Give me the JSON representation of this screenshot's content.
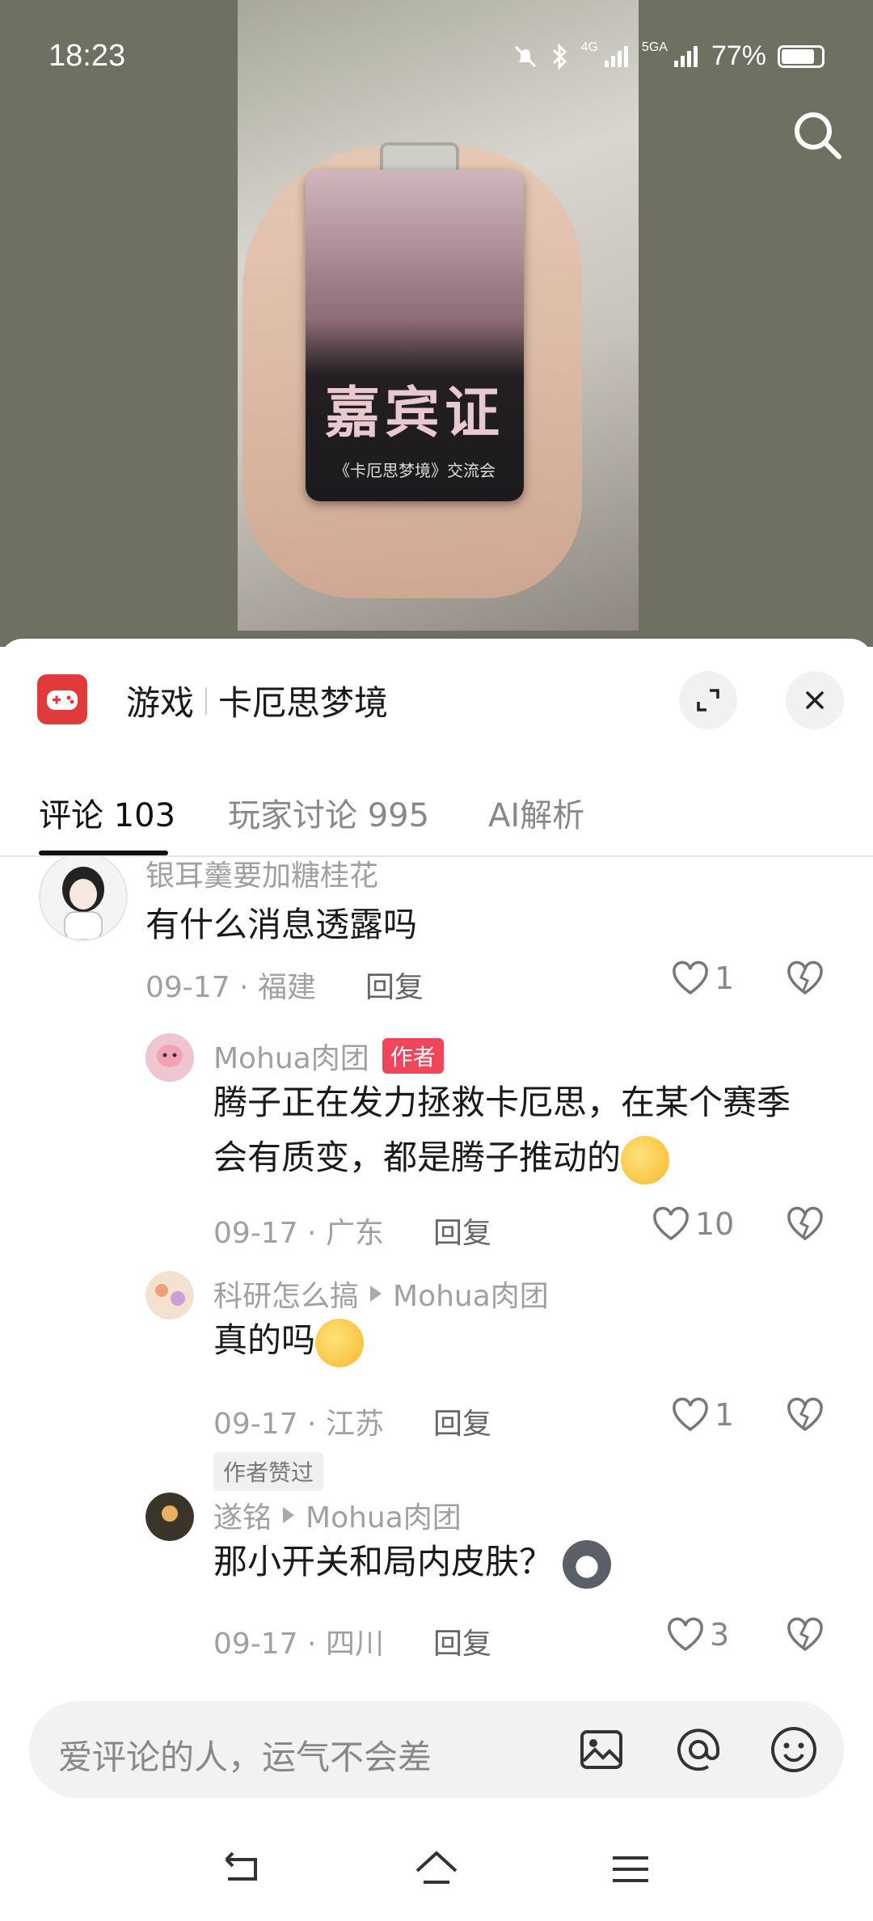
{
  "status_bar": {
    "time": "18:23",
    "network_1": "4G",
    "network_2": "5GA",
    "battery": "77%"
  },
  "video": {
    "pass_title": "嘉宾证",
    "pass_subtitle": "《卡厄思梦境》交流会"
  },
  "sheet": {
    "header": {
      "category": "游戏",
      "title": "卡厄思梦境"
    },
    "tabs": [
      {
        "label": "评论",
        "count": "103"
      },
      {
        "label": "玩家讨论",
        "count": "995"
      },
      {
        "label": "AI解析",
        "count": ""
      }
    ]
  },
  "comments": [
    {
      "user": "银耳羹要加糖桂花",
      "text": "有什么消息透露吗",
      "date": "09-17 · 福建",
      "reply": "回复",
      "likes": "1"
    },
    {
      "user": "Mohua肉团",
      "tag": "作者",
      "text_line1": "腾子正在发力拯救卡厄思，在某个赛季",
      "text_line2": "会有质变，都是腾子推动的",
      "date": "09-17 · 广东",
      "reply": "回复",
      "likes": "10"
    },
    {
      "user": "科研怎么搞",
      "reply_to": "Mohua肉团",
      "text": "真的吗",
      "date": "09-17 · 江苏",
      "reply": "回复",
      "likes": "1",
      "badge": "作者赞过"
    },
    {
      "user": "遂铭",
      "reply_to": "Mohua肉团",
      "text": "那小开关和局内皮肤？",
      "date": "09-17 · 四川",
      "reply": "回复",
      "likes": "3"
    }
  ],
  "input": {
    "placeholder": "爱评论的人，运气不会差"
  }
}
